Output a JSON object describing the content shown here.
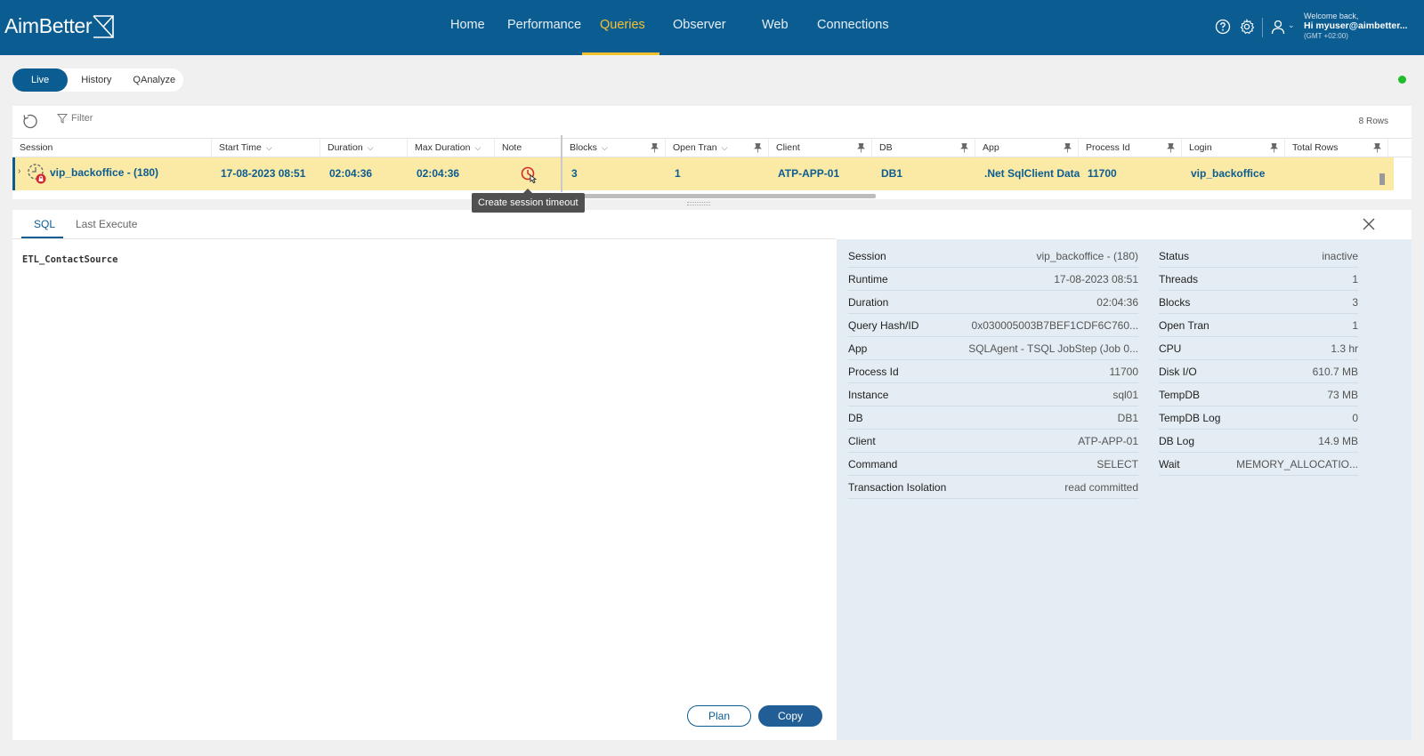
{
  "header": {
    "logo_text": "AimBetter",
    "nav": [
      "Home",
      "Performance",
      "Queries",
      "Observer",
      "Web",
      "Connections"
    ],
    "active_nav": "Queries",
    "user": {
      "greeting": "Welcome back,",
      "name": "Hi myuser@aimbetter...",
      "timezone": "(GMT +02:00)"
    }
  },
  "mode_tabs": [
    "Live",
    "History",
    "QAnalyze"
  ],
  "active_mode": "Live",
  "grid": {
    "filter_label": "Filter",
    "rows_count": "8 Rows",
    "columns": [
      "Session",
      "Start Time",
      "Duration",
      "Max Duration",
      "Note",
      "Blocks",
      "Open Tran",
      "Client",
      "DB",
      "App",
      "Process Id",
      "Login",
      "Total Rows"
    ],
    "row": {
      "session": "vip_backoffice - (180)",
      "start_time": "17-08-2023 08:51",
      "duration": "02:04:36",
      "max_duration": "02:04:36",
      "blocks": "3",
      "open_tran": "1",
      "client": "ATP-APP-01",
      "db": "DB1",
      "app": ".Net SqlClient Data P",
      "process_id": "11700",
      "login": "vip_backoffice"
    },
    "tooltip": "Create session timeout"
  },
  "detail": {
    "tabs": [
      "SQL",
      "Last Execute"
    ],
    "active_tab": "SQL",
    "sql": "ETL_ContactSource",
    "plan_label": "Plan",
    "copy_label": "Copy",
    "left_info": [
      {
        "k": "Session",
        "v": "vip_backoffice - (180)"
      },
      {
        "k": "Runtime",
        "v": "17-08-2023 08:51"
      },
      {
        "k": "Duration",
        "v": "02:04:36"
      },
      {
        "k": "Query Hash/ID",
        "v": "0x030005003B7BEF1CDF6C760..."
      },
      {
        "k": "App",
        "v": "SQLAgent - TSQL JobStep (Job 0..."
      },
      {
        "k": "Process Id",
        "v": "11700"
      },
      {
        "k": "Instance",
        "v": "sql01"
      },
      {
        "k": "DB",
        "v": "DB1"
      },
      {
        "k": "Client",
        "v": "ATP-APP-01"
      },
      {
        "k": "Command",
        "v": "SELECT"
      },
      {
        "k": "Transaction Isolation",
        "v": "read committed"
      }
    ],
    "right_info": [
      {
        "k": "Status",
        "v": "inactive"
      },
      {
        "k": "Threads",
        "v": "1"
      },
      {
        "k": "Blocks",
        "v": "3"
      },
      {
        "k": "Open Tran",
        "v": "1"
      },
      {
        "k": "CPU",
        "v": "1.3 hr"
      },
      {
        "k": "Disk I/O",
        "v": "610.7 MB"
      },
      {
        "k": "TempDB",
        "v": "73 MB"
      },
      {
        "k": "TempDB Log",
        "v": "0"
      },
      {
        "k": "DB Log",
        "v": "14.9 MB"
      },
      {
        "k": "Wait",
        "v": "MEMORY_ALLOCATIO..."
      }
    ]
  },
  "colors": {
    "brand": "#0b5d91",
    "accent": "#f5c131",
    "row_highlight": "#fbe9a6",
    "online": "#1fbd2b"
  }
}
